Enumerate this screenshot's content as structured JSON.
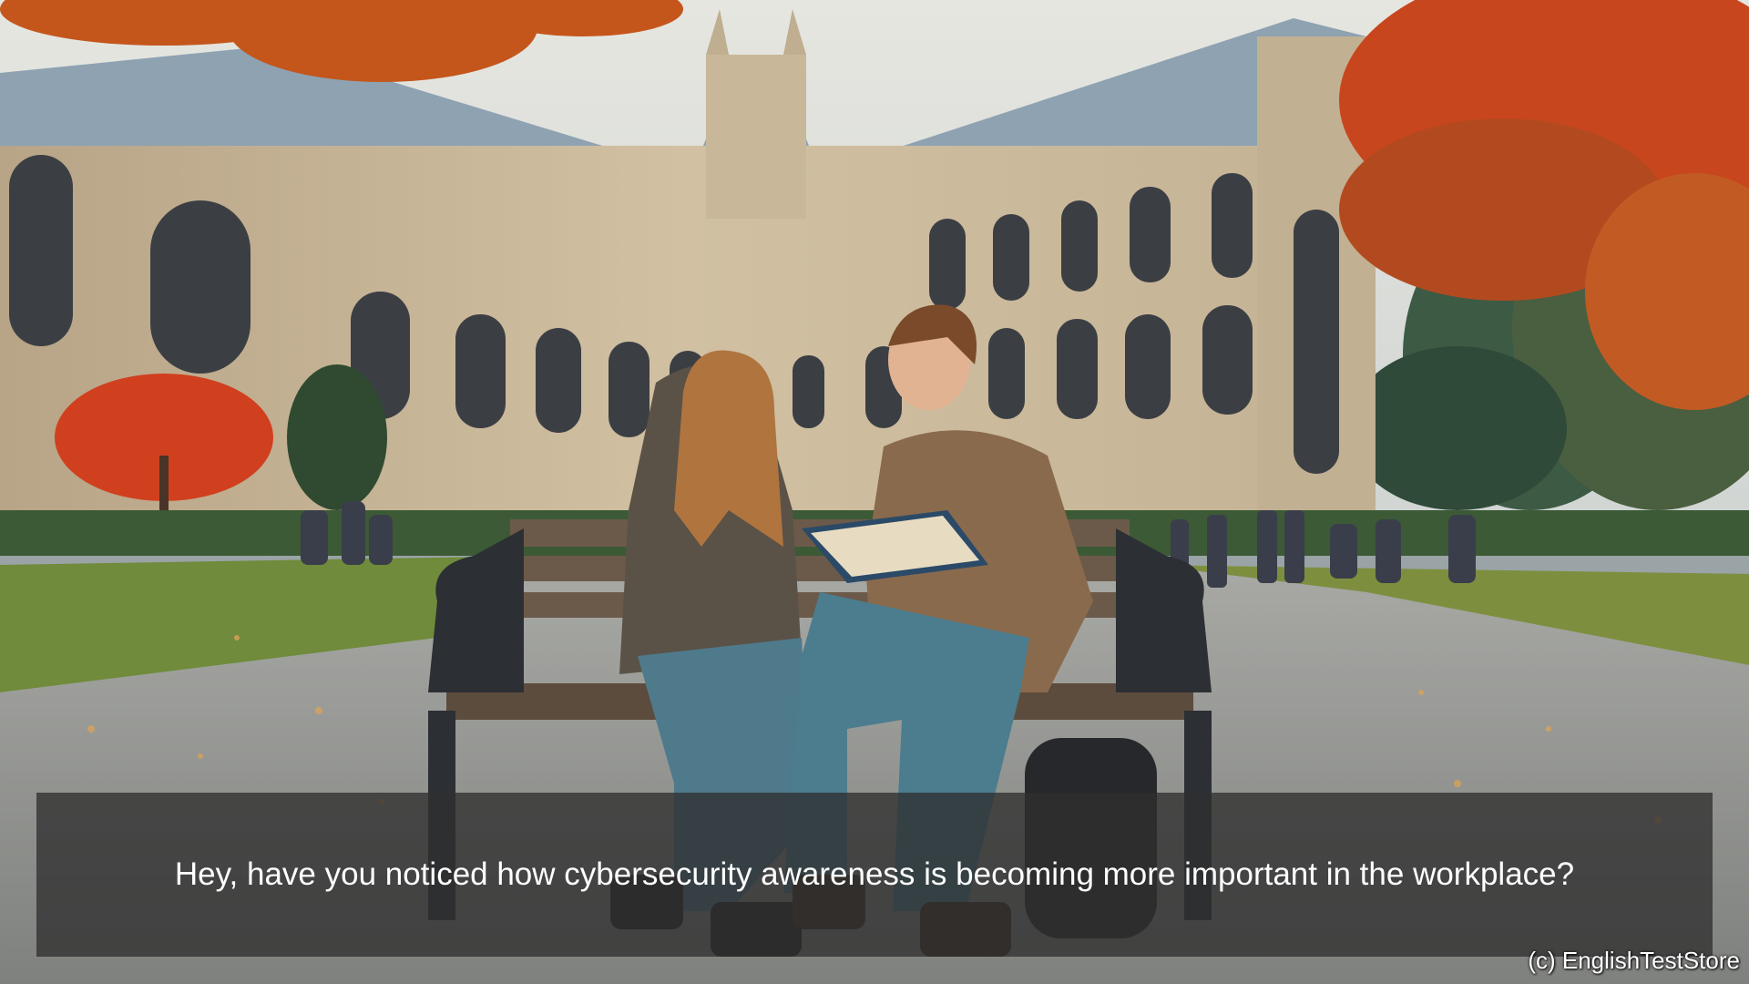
{
  "caption": {
    "text": "Hey, have you noticed how cybersecurity awareness is becoming more important in the workplace?"
  },
  "watermark": {
    "text": "(c) EnglishTestStore"
  },
  "scene": {
    "description_icon": "campus-photo-illustration",
    "colors": {
      "sky": "#d9dcd8",
      "stone": "#c9b79a",
      "roof": "#8fa4b3",
      "autumn_foliage": "#c8501e",
      "lawn": "#6e8a3a",
      "pavement": "#9b9d9a",
      "bench_wood": "#6b5a4a"
    }
  }
}
